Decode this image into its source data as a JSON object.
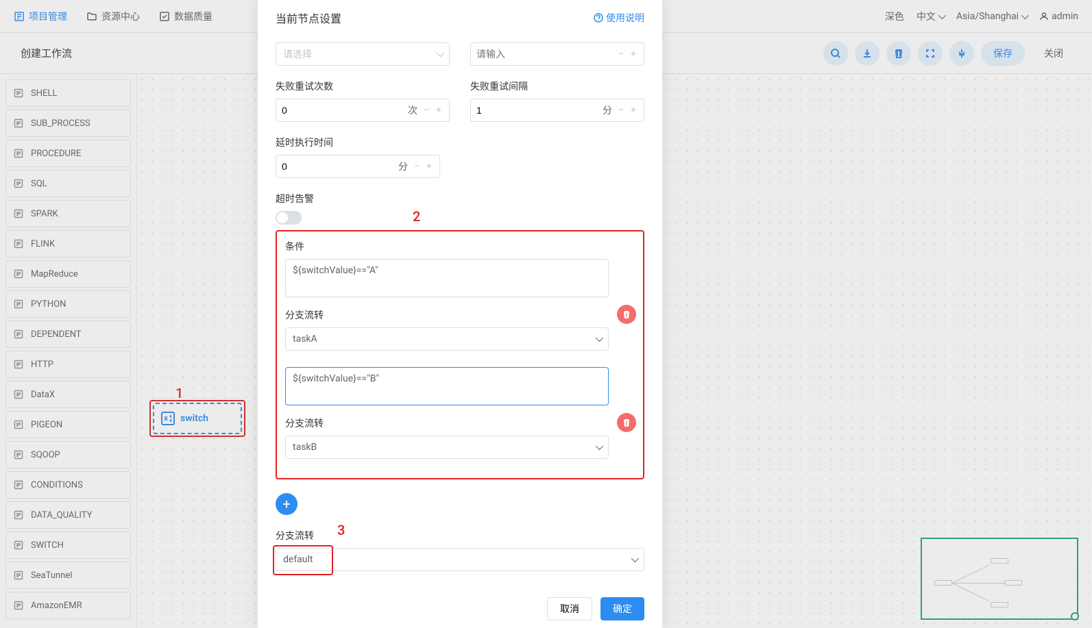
{
  "header": {
    "nav": [
      {
        "label": "项目管理",
        "active": true
      },
      {
        "label": "资源中心",
        "active": false
      },
      {
        "label": "数据质量",
        "active": false,
        "clipped": true
      }
    ],
    "theme": "深色",
    "language": "中文",
    "timezone": "Asia/Shanghai",
    "user": "admin"
  },
  "subheader": {
    "title": "创建工作流",
    "save": "保存",
    "close": "关闭"
  },
  "sidebar": {
    "items": [
      "SHELL",
      "SUB_PROCESS",
      "PROCEDURE",
      "SQL",
      "SPARK",
      "FLINK",
      "MapReduce",
      "PYTHON",
      "DEPENDENT",
      "HTTP",
      "DataX",
      "PIGEON",
      "SQOOP",
      "CONDITIONS",
      "DATA_QUALITY",
      "SWITCH",
      "SeaTunnel",
      "AmazonEMR"
    ]
  },
  "canvas": {
    "node_label": "switch",
    "annotation1": "1"
  },
  "modal": {
    "title": "当前节点设置",
    "help": "使用说明",
    "select_placeholder": "请选择",
    "input_placeholder": "请输入",
    "retry_count_label": "失败重试次数",
    "retry_count_value": "0",
    "retry_count_unit": "次",
    "retry_interval_label": "失败重试间隔",
    "retry_interval_value": "1",
    "retry_interval_unit": "分",
    "delay_label": "延时执行时间",
    "delay_value": "0",
    "delay_unit": "分",
    "timeout_label": "超时告警",
    "annotation2": "2",
    "condition_label": "条件",
    "branch_label": "分支流转",
    "conditions": [
      {
        "expr": "${switchValue}==\"A\"",
        "branch": "taskA",
        "focused": false
      },
      {
        "expr": "${switchValue}==\"B\"",
        "branch": "taskB",
        "focused": true
      }
    ],
    "annotation3": "3",
    "default_branch_label": "分支流转",
    "default_branch_value": "default",
    "cancel": "取消",
    "confirm": "确定"
  }
}
